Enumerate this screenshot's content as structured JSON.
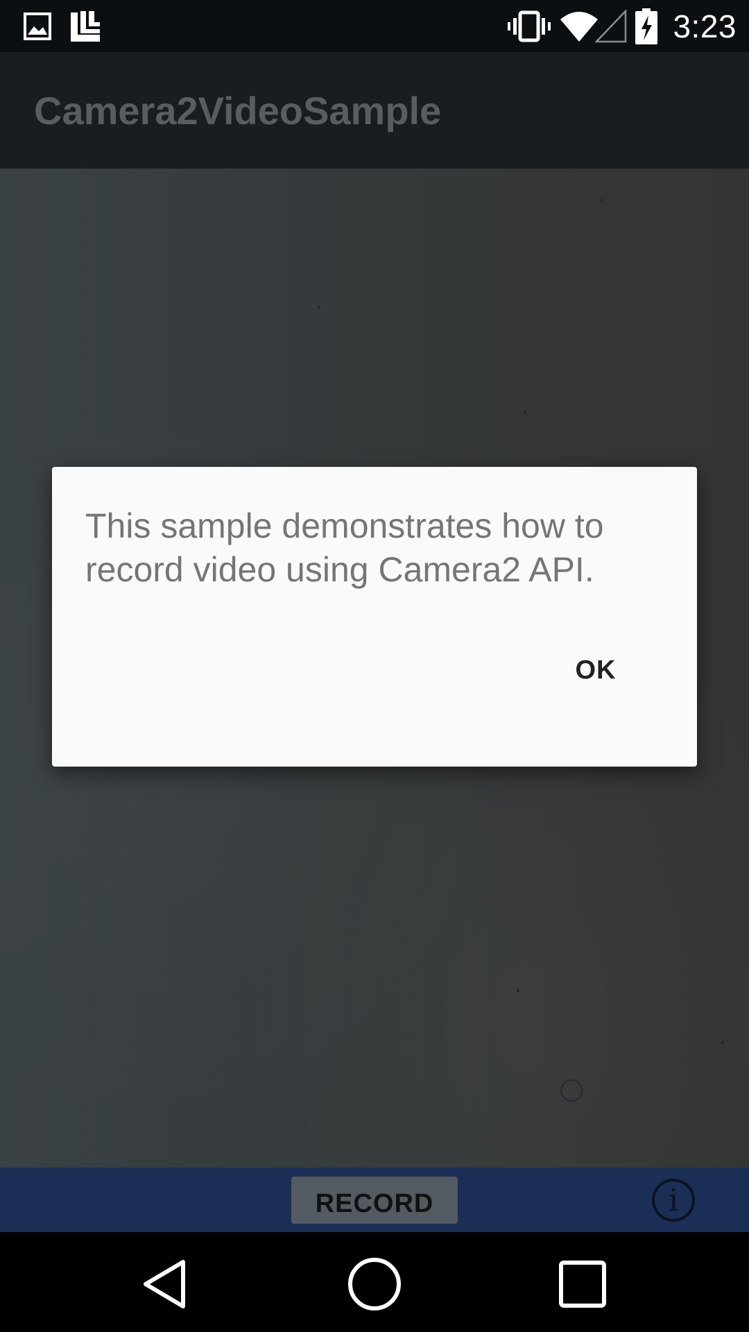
{
  "status_bar": {
    "time": "3:23",
    "icons": [
      "image-notification-icon",
      "app-notification-icon",
      "vibrate-icon",
      "wifi-icon",
      "no-signal-icon",
      "battery-charging-icon"
    ]
  },
  "app_bar": {
    "title": "Camera2VideoSample"
  },
  "dialog": {
    "message": "This sample demonstrates how to record video using Camera2 API.",
    "ok_label": "OK"
  },
  "controls": {
    "record_label": "RECORD",
    "info_icon": "info-icon",
    "info_glyph": "i"
  },
  "nav_bar": {
    "icons": [
      "back-icon",
      "home-icon",
      "recents-icon"
    ]
  },
  "colors": {
    "app_bar": "#191d21",
    "control_bar": "#1b2e55",
    "dialog_bg": "#fafafa"
  }
}
